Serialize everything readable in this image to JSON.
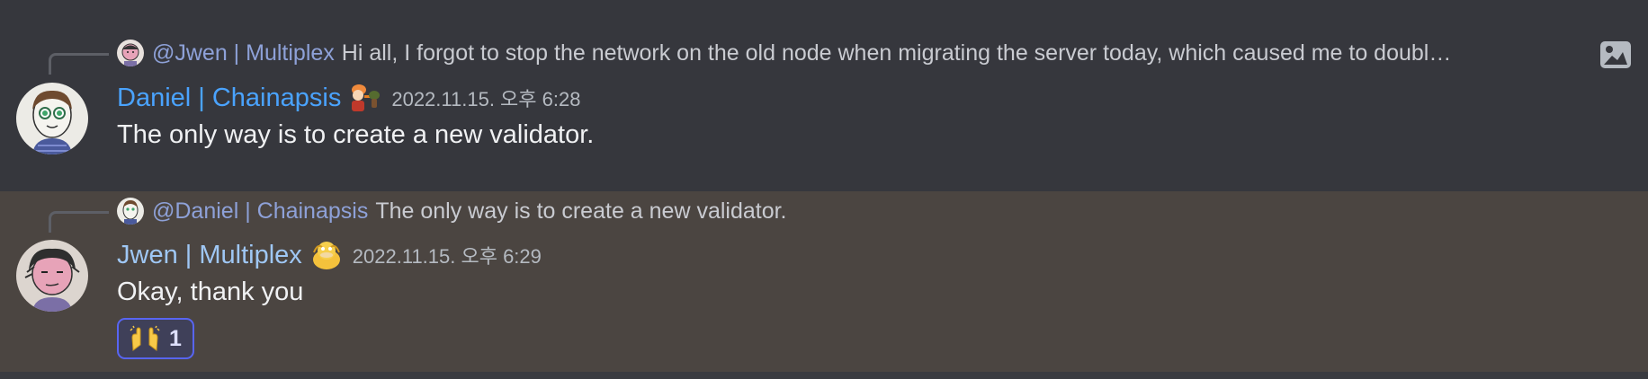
{
  "colors": {
    "channel_bg": "#313338",
    "first_message_bg": "#36373d",
    "highlighted_message_bg": "#4b4541",
    "mention": "#8ea1d8",
    "username_daniel": "#4aa3ff",
    "username_jwen": "#9fc7f4",
    "reaction_border": "#5865f2"
  },
  "messages": [
    {
      "reply": {
        "mention": "@Jwen | Multiplex",
        "text": "Hi all, I forgot to stop the network on the old node when migrating the server today, which caused me to double si...",
        "avatar_icon": "avatar-jwen-icon",
        "attachment_icon": "image-icon"
      },
      "author": "Daniel | Chainapsis",
      "badge_icon": "character-badge-icon",
      "timestamp": "2022.11.15. 오후 6:28",
      "content": "The only way is to create a new validator."
    },
    {
      "reply": {
        "mention": "@Daniel | Chainapsis",
        "text": "The only way is to create a new validator.",
        "avatar_icon": "avatar-daniel-icon"
      },
      "author": "Jwen | Multiplex",
      "badge_icon": "psyduck-badge-icon",
      "timestamp": "2022.11.15. 오후 6:29",
      "content": "Okay, thank you",
      "reaction": {
        "emoji_icon": "raising-hands-icon",
        "count": "1"
      }
    }
  ]
}
